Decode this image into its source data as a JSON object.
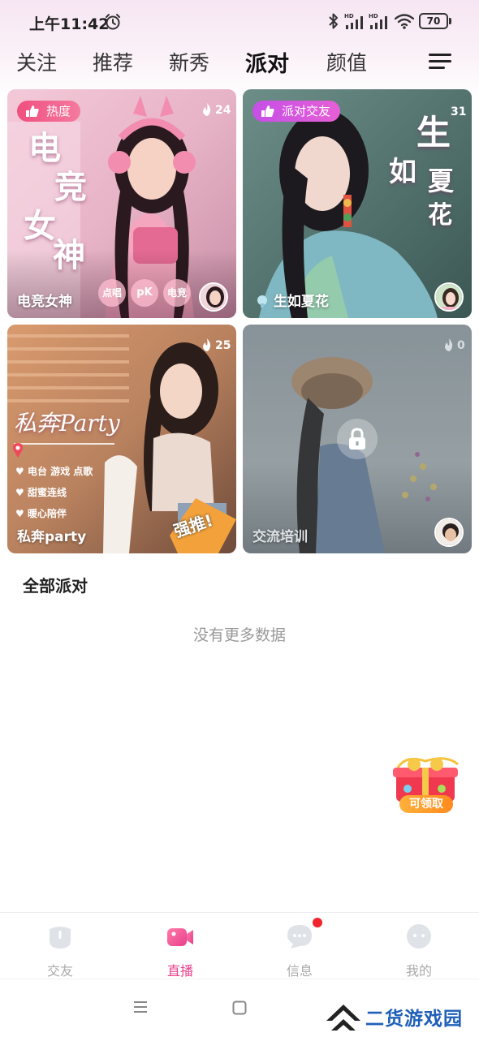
{
  "status_bar": {
    "time": "上午11:42",
    "battery": "70",
    "signal_label": "HD"
  },
  "tabs": [
    {
      "label": "关注"
    },
    {
      "label": "推荐"
    },
    {
      "label": "新秀"
    },
    {
      "label": "派对"
    },
    {
      "label": "颜值"
    }
  ],
  "active_tab": "派对",
  "cards": [
    {
      "name": "电竞女神",
      "badge": "热度",
      "heat": "24",
      "overlay_title": [
        "电",
        "竞",
        "女",
        "神"
      ],
      "tags": [
        "点唱",
        "pK",
        "电竞"
      ]
    },
    {
      "name": "生如夏花",
      "badge": "派对交友",
      "heat": "31",
      "overlay_title": [
        "生",
        "如",
        "夏",
        "花"
      ]
    },
    {
      "name": "私奔party",
      "heat": "25",
      "overlay_title": "私奔Party",
      "features": [
        "电台 游戏 点歌",
        "甜蜜连线",
        "暖心陪伴"
      ],
      "stamp": "强推!"
    },
    {
      "name": "交流培训",
      "heat": "0",
      "locked": true
    }
  ],
  "section": {
    "title": "全部派对",
    "empty_text": "没有更多数据"
  },
  "gift": {
    "label": "可领取"
  },
  "bottom_nav": [
    {
      "label": "交友",
      "icon": "friends-icon"
    },
    {
      "label": "直播",
      "icon": "live-camera-icon"
    },
    {
      "label": "信息",
      "icon": "message-icon"
    },
    {
      "label": "我的",
      "icon": "profile-icon"
    }
  ],
  "active_nav": "直播",
  "watermark": {
    "text": "二货游戏园"
  },
  "colors": {
    "accent_pink": "#e8408c",
    "badge_hot": "#f04f7f",
    "badge_party": "#d04fe0",
    "notification_dot": "#f0252d",
    "inactive": "#aaaaaa"
  }
}
